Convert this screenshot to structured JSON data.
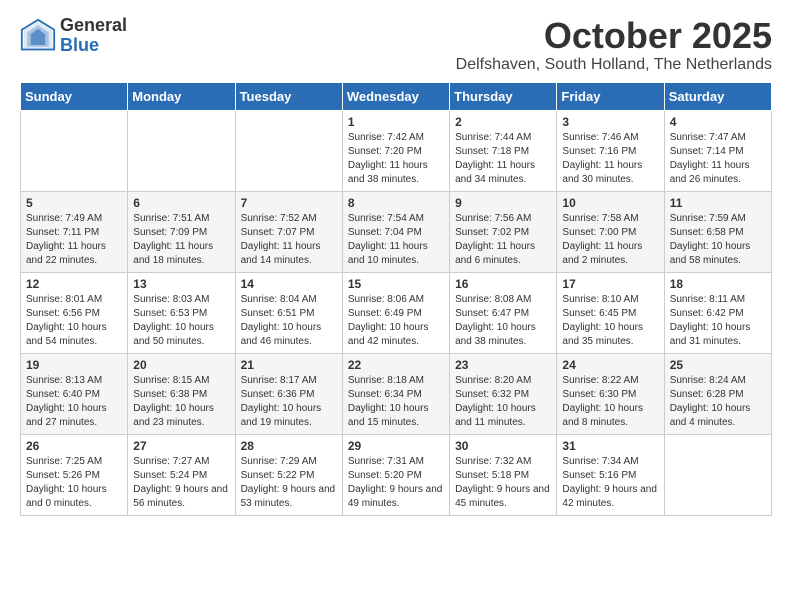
{
  "header": {
    "logo_general": "General",
    "logo_blue": "Blue",
    "month_title": "October 2025",
    "subtitle": "Delfshaven, South Holland, The Netherlands"
  },
  "days_of_week": [
    "Sunday",
    "Monday",
    "Tuesday",
    "Wednesday",
    "Thursday",
    "Friday",
    "Saturday"
  ],
  "weeks": [
    [
      {
        "day": "",
        "info": ""
      },
      {
        "day": "",
        "info": ""
      },
      {
        "day": "",
        "info": ""
      },
      {
        "day": "1",
        "info": "Sunrise: 7:42 AM\nSunset: 7:20 PM\nDaylight: 11 hours and 38 minutes."
      },
      {
        "day": "2",
        "info": "Sunrise: 7:44 AM\nSunset: 7:18 PM\nDaylight: 11 hours and 34 minutes."
      },
      {
        "day": "3",
        "info": "Sunrise: 7:46 AM\nSunset: 7:16 PM\nDaylight: 11 hours and 30 minutes."
      },
      {
        "day": "4",
        "info": "Sunrise: 7:47 AM\nSunset: 7:14 PM\nDaylight: 11 hours and 26 minutes."
      }
    ],
    [
      {
        "day": "5",
        "info": "Sunrise: 7:49 AM\nSunset: 7:11 PM\nDaylight: 11 hours and 22 minutes."
      },
      {
        "day": "6",
        "info": "Sunrise: 7:51 AM\nSunset: 7:09 PM\nDaylight: 11 hours and 18 minutes."
      },
      {
        "day": "7",
        "info": "Sunrise: 7:52 AM\nSunset: 7:07 PM\nDaylight: 11 hours and 14 minutes."
      },
      {
        "day": "8",
        "info": "Sunrise: 7:54 AM\nSunset: 7:04 PM\nDaylight: 11 hours and 10 minutes."
      },
      {
        "day": "9",
        "info": "Sunrise: 7:56 AM\nSunset: 7:02 PM\nDaylight: 11 hours and 6 minutes."
      },
      {
        "day": "10",
        "info": "Sunrise: 7:58 AM\nSunset: 7:00 PM\nDaylight: 11 hours and 2 minutes."
      },
      {
        "day": "11",
        "info": "Sunrise: 7:59 AM\nSunset: 6:58 PM\nDaylight: 10 hours and 58 minutes."
      }
    ],
    [
      {
        "day": "12",
        "info": "Sunrise: 8:01 AM\nSunset: 6:56 PM\nDaylight: 10 hours and 54 minutes."
      },
      {
        "day": "13",
        "info": "Sunrise: 8:03 AM\nSunset: 6:53 PM\nDaylight: 10 hours and 50 minutes."
      },
      {
        "day": "14",
        "info": "Sunrise: 8:04 AM\nSunset: 6:51 PM\nDaylight: 10 hours and 46 minutes."
      },
      {
        "day": "15",
        "info": "Sunrise: 8:06 AM\nSunset: 6:49 PM\nDaylight: 10 hours and 42 minutes."
      },
      {
        "day": "16",
        "info": "Sunrise: 8:08 AM\nSunset: 6:47 PM\nDaylight: 10 hours and 38 minutes."
      },
      {
        "day": "17",
        "info": "Sunrise: 8:10 AM\nSunset: 6:45 PM\nDaylight: 10 hours and 35 minutes."
      },
      {
        "day": "18",
        "info": "Sunrise: 8:11 AM\nSunset: 6:42 PM\nDaylight: 10 hours and 31 minutes."
      }
    ],
    [
      {
        "day": "19",
        "info": "Sunrise: 8:13 AM\nSunset: 6:40 PM\nDaylight: 10 hours and 27 minutes."
      },
      {
        "day": "20",
        "info": "Sunrise: 8:15 AM\nSunset: 6:38 PM\nDaylight: 10 hours and 23 minutes."
      },
      {
        "day": "21",
        "info": "Sunrise: 8:17 AM\nSunset: 6:36 PM\nDaylight: 10 hours and 19 minutes."
      },
      {
        "day": "22",
        "info": "Sunrise: 8:18 AM\nSunset: 6:34 PM\nDaylight: 10 hours and 15 minutes."
      },
      {
        "day": "23",
        "info": "Sunrise: 8:20 AM\nSunset: 6:32 PM\nDaylight: 10 hours and 11 minutes."
      },
      {
        "day": "24",
        "info": "Sunrise: 8:22 AM\nSunset: 6:30 PM\nDaylight: 10 hours and 8 minutes."
      },
      {
        "day": "25",
        "info": "Sunrise: 8:24 AM\nSunset: 6:28 PM\nDaylight: 10 hours and 4 minutes."
      }
    ],
    [
      {
        "day": "26",
        "info": "Sunrise: 7:25 AM\nSunset: 5:26 PM\nDaylight: 10 hours and 0 minutes."
      },
      {
        "day": "27",
        "info": "Sunrise: 7:27 AM\nSunset: 5:24 PM\nDaylight: 9 hours and 56 minutes."
      },
      {
        "day": "28",
        "info": "Sunrise: 7:29 AM\nSunset: 5:22 PM\nDaylight: 9 hours and 53 minutes."
      },
      {
        "day": "29",
        "info": "Sunrise: 7:31 AM\nSunset: 5:20 PM\nDaylight: 9 hours and 49 minutes."
      },
      {
        "day": "30",
        "info": "Sunrise: 7:32 AM\nSunset: 5:18 PM\nDaylight: 9 hours and 45 minutes."
      },
      {
        "day": "31",
        "info": "Sunrise: 7:34 AM\nSunset: 5:16 PM\nDaylight: 9 hours and 42 minutes."
      },
      {
        "day": "",
        "info": ""
      }
    ]
  ]
}
